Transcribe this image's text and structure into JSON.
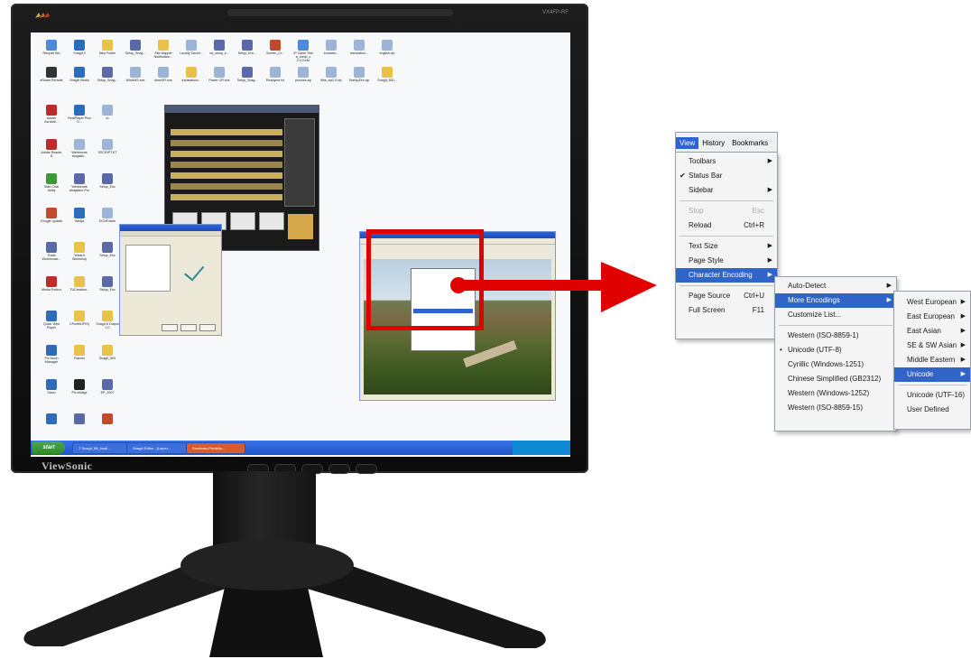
{
  "monitor": {
    "brand": "ViewSonic",
    "model": "VX4FP-RF"
  },
  "desktop": {
    "icons": [
      {
        "label": "Recycle Bin",
        "color": "#4a8ad8"
      },
      {
        "label": "SnagIt 9",
        "color": "#2d6cb8"
      },
      {
        "label": "New Folder",
        "color": "#e8c24a"
      },
      {
        "label": "Setup_Snag...",
        "color": "#5a6aa8"
      },
      {
        "label": "Site Mapper Notification...",
        "color": "#e8c24a"
      },
      {
        "label": "Locally Saved...",
        "color": "#9cb4d8"
      },
      {
        "label": "cd_setup_s...",
        "color": "#5a6aa8"
      },
      {
        "label": "Setup_Enc...",
        "color": "#5a6aa8"
      },
      {
        "label": "Screen_Cr...",
        "color": "#c04a2a"
      },
      {
        "label": "IP Cable Test a_comp_c 2.0.0.exe",
        "color": "#4a8ad8"
      },
      {
        "label": "kunacks...",
        "color": "#9cb4d8"
      },
      {
        "label": "translation...",
        "color": "#9cb4d8"
      },
      {
        "label": "english.zip",
        "color": "#9cb4d8"
      },
      {
        "label": "eRoam Remote",
        "color": "#333333"
      },
      {
        "label": "SnagIt Studio",
        "color": "#2d6cb8"
      },
      {
        "label": "Setup_Snag...",
        "color": "#5a6aa8"
      },
      {
        "label": "WinAMS.exe",
        "color": "#9cb4d8"
      },
      {
        "label": "direcSR.exe",
        "color": "#9cb4d8"
      },
      {
        "label": "translationv...",
        "color": "#e8c24a"
      },
      {
        "label": "Power CR.exe",
        "color": "#9cb4d8"
      },
      {
        "label": "Setup_Snag...",
        "color": "#5a6aa8"
      },
      {
        "label": "Readyme.txt",
        "color": "#9cb4d8"
      },
      {
        "label": "process.zip",
        "color": "#9cb4d8"
      },
      {
        "label": "files_sw2.0.zip",
        "color": "#9cb4d8"
      },
      {
        "label": "TestApZen.zip",
        "color": "#9cb4d8"
      },
      {
        "label": "SnagIt_800...",
        "color": "#e8c24a"
      },
      {
        "label": "Adobe Acrobat...",
        "color": "#c02a2a"
      },
      {
        "label": "RealPlayer Plus G...",
        "color": "#2d6cb8"
      },
      {
        "label": "v1",
        "color": "#9cb4d8"
      },
      {
        "label": "Adobe Reader 8",
        "color": "#c02a2a"
      },
      {
        "label": "Webtrends ahajakin...",
        "color": "#9cb4d8"
      },
      {
        "label": "SSCRIPT.KT",
        "color": "#9cb4d8"
      },
      {
        "label": "Start Click Utility",
        "color": "#3a9a3a"
      },
      {
        "label": "Webtrends ahajakino Pro",
        "color": "#5a6aa8"
      },
      {
        "label": "Setup_Enc",
        "color": "#5a6aa8"
      },
      {
        "label": "Google Update",
        "color": "#c04a2a"
      },
      {
        "label": "Wedja",
        "color": "#2d6cb8"
      },
      {
        "label": "DCNF.txtes",
        "color": "#9cb4d8"
      },
      {
        "label": "Trade Workhouse...",
        "color": "#5a6aa8"
      },
      {
        "label": "Wizard Workshop",
        "color": "#e8c24a"
      },
      {
        "label": "Setup_Enc",
        "color": "#5a6aa8"
      },
      {
        "label": "Media Portico",
        "color": "#c02a2a"
      },
      {
        "label": "TUCreation...",
        "color": "#e8c24a"
      },
      {
        "label": "Setup_Enc",
        "color": "#5a6aa8"
      },
      {
        "label": "Quick View Player",
        "color": "#2d6cb8"
      },
      {
        "label": "CPorterDPIS)",
        "color": "#e8c24a"
      },
      {
        "label": "SnagIt 8 Output 2.0",
        "color": "#e8c24a"
      },
      {
        "label": "Pix Moon Manager",
        "color": "#2d6cb8"
      },
      {
        "label": "Frames",
        "color": "#e8c24a"
      },
      {
        "label": "SnagIt_800",
        "color": "#e8c24a"
      },
      {
        "label": "Salon",
        "color": "#2d6cb8"
      },
      {
        "label": "Pix eMage",
        "color": "#222222"
      },
      {
        "label": "EP_2007",
        "color": "#5a6aa8"
      },
      {
        "label": "",
        "color": "#2d6cb8"
      },
      {
        "label": "",
        "color": "#5a6aa8"
      },
      {
        "label": "",
        "color": "#c04a2a"
      }
    ]
  },
  "taskbar": {
    "start_label": "start",
    "items": [
      "7 SnagIt_85_finali...",
      "SnagIt Editor - [Layou...",
      "Seminars-Portfolio..."
    ],
    "clock": "12:21 PM"
  },
  "menubar": {
    "tabs": [
      "View",
      "History",
      "Bookmarks"
    ],
    "active_index": 0
  },
  "view_menu": {
    "items": [
      {
        "label": "Toolbars",
        "shortcut": "",
        "submenu": true
      },
      {
        "label": "Status Bar",
        "checked": true
      },
      {
        "label": "Sidebar",
        "submenu": true
      },
      {
        "sep": true
      },
      {
        "label": "Stop",
        "shortcut": "Esc",
        "disabled": true
      },
      {
        "label": "Reload",
        "shortcut": "Ctrl+R"
      },
      {
        "sep": true
      },
      {
        "label": "Text Size",
        "submenu": true
      },
      {
        "label": "Page Style",
        "submenu": true
      },
      {
        "label": "Character Encoding",
        "submenu": true,
        "highlighted": true
      },
      {
        "sep": true
      },
      {
        "label": "Page Source",
        "shortcut": "Ctrl+U"
      },
      {
        "label": "Full Screen",
        "shortcut": "F11"
      }
    ]
  },
  "encoding_menu": {
    "items": [
      {
        "label": "Auto-Detect",
        "submenu": true
      },
      {
        "label": "More Encodings",
        "submenu": true,
        "highlighted": true
      },
      {
        "label": "Customize List..."
      },
      {
        "sep": true
      },
      {
        "label": "Western (ISO-8859-1)"
      },
      {
        "label": "Unicode (UTF-8)",
        "selected": true
      },
      {
        "label": "Cyrillic (Windows-1251)"
      },
      {
        "label": "Chinese Simplified (GB2312)"
      },
      {
        "label": "Western (Windows-1252)"
      },
      {
        "label": "Western (ISO-8859-15)"
      }
    ]
  },
  "more_encodings_menu": {
    "items": [
      {
        "label": "West European",
        "submenu": true
      },
      {
        "label": "East European",
        "submenu": true
      },
      {
        "label": "East Asian",
        "submenu": true
      },
      {
        "label": "SE & SW Asian",
        "submenu": true
      },
      {
        "label": "Middle Eastern",
        "submenu": true
      },
      {
        "label": "Unicode",
        "submenu": true,
        "highlighted": true
      },
      {
        "sep": true
      },
      {
        "label": "Unicode (UTF-16)"
      },
      {
        "label": "User Defined"
      }
    ]
  },
  "colors": {
    "highlight_red": "#e00000",
    "menu_selection_blue": "#3164c9"
  }
}
